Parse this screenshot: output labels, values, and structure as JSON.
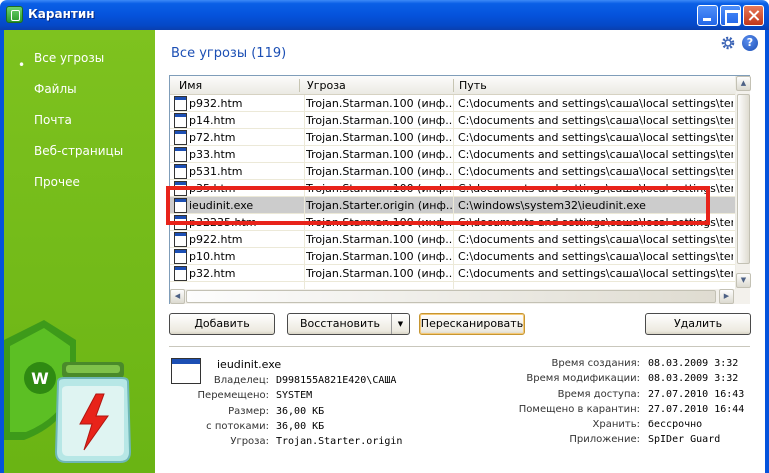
{
  "window": {
    "title": "Карантин"
  },
  "sidebar": {
    "items": [
      {
        "label": "Все угрозы"
      },
      {
        "label": "Файлы"
      },
      {
        "label": "Почта"
      },
      {
        "label": "Веб-страницы"
      },
      {
        "label": "Прочее"
      }
    ],
    "bullet": "•"
  },
  "main": {
    "heading": "Все угрозы (119)",
    "help_label": "?"
  },
  "table": {
    "columns": [
      "Имя",
      "Угроза",
      "Путь"
    ],
    "rows": [
      {
        "name": "p932.htm",
        "threat": "Trojan.Starman.100 (инф...",
        "path": "C:\\documents and settings\\саша\\local settings\\temp\\ra..."
      },
      {
        "name": "p14.htm",
        "threat": "Trojan.Starman.100 (инф...",
        "path": "C:\\documents and settings\\саша\\local settings\\temp\\ra..."
      },
      {
        "name": "p72.htm",
        "threat": "Trojan.Starman.100 (инф...",
        "path": "C:\\documents and settings\\саша\\local settings\\temp\\ra..."
      },
      {
        "name": "p33.htm",
        "threat": "Trojan.Starman.100 (инф...",
        "path": "C:\\documents and settings\\саша\\local settings\\temp\\ra..."
      },
      {
        "name": "p531.htm",
        "threat": "Trojan.Starman.100 (инф...",
        "path": "C:\\documents and settings\\саша\\local settings\\temp\\ra..."
      },
      {
        "name": "p35.htm",
        "threat": "Trojan.Starman.100 (инф...",
        "path": "C:\\documents and settings\\саша\\local settings\\temp\\ra..."
      },
      {
        "name": "ieudinit.exe",
        "threat": "Trojan.Starter.origin (инф...",
        "path": "C:\\windows\\system32\\ieudinit.exe"
      },
      {
        "name": "p32235.htm",
        "threat": "Trojan.Starman.100 (инф...",
        "path": "C:\\documents and settings\\саша\\local settings\\temp\\ra..."
      },
      {
        "name": "p922.htm",
        "threat": "Trojan.Starman.100 (инф...",
        "path": "C:\\documents and settings\\саша\\local settings\\temp\\ra..."
      },
      {
        "name": "p10.htm",
        "threat": "Trojan.Starman.100 (инф...",
        "path": "C:\\documents and settings\\саша\\local settings\\temp\\ra..."
      },
      {
        "name": "p32.htm",
        "threat": "Trojan.Starman.100 (инф...",
        "path": "C:\\documents and settings\\саша\\local settings\\temp\\ra..."
      },
      {
        "name": "",
        "threat": "",
        "path": ""
      }
    ],
    "selected_index": 6
  },
  "buttons": {
    "add": "Добавить",
    "restore": "Восстановить",
    "restore_arrow": "▼",
    "rescan": "Пересканировать",
    "delete": "Удалить"
  },
  "details": {
    "filename": "ieudinit.exe",
    "left": [
      {
        "label": "Владелец:",
        "value": "D998155A821E420\\САША"
      },
      {
        "label": "Перемещено:",
        "value": "SYSTEM"
      },
      {
        "label": "Размер:",
        "value": "36,00 КБ"
      },
      {
        "label": "с потоками:",
        "value": "36,00 КБ"
      },
      {
        "label": "Угроза:",
        "value": "Trojan.Starter.origin"
      }
    ],
    "right": [
      {
        "label": "Время создания:",
        "value": "08.03.2009 3:32"
      },
      {
        "label": "Время модификации:",
        "value": "08.03.2009 3:32"
      },
      {
        "label": "Время доступа:",
        "value": "27.07.2010 16:43"
      },
      {
        "label": "Помещено в карантин:",
        "value": "27.07.2010 16:44"
      },
      {
        "label": "Хранить:",
        "value": "бессрочно"
      },
      {
        "label": "Приложение:",
        "value": "SpIDer Guard"
      }
    ]
  },
  "colors": {
    "sidebar_green": "#7ec21f",
    "heading_blue": "#1c4fb4",
    "highlight_red": "#e8231a",
    "titlebar_blue": "#0553dc"
  }
}
